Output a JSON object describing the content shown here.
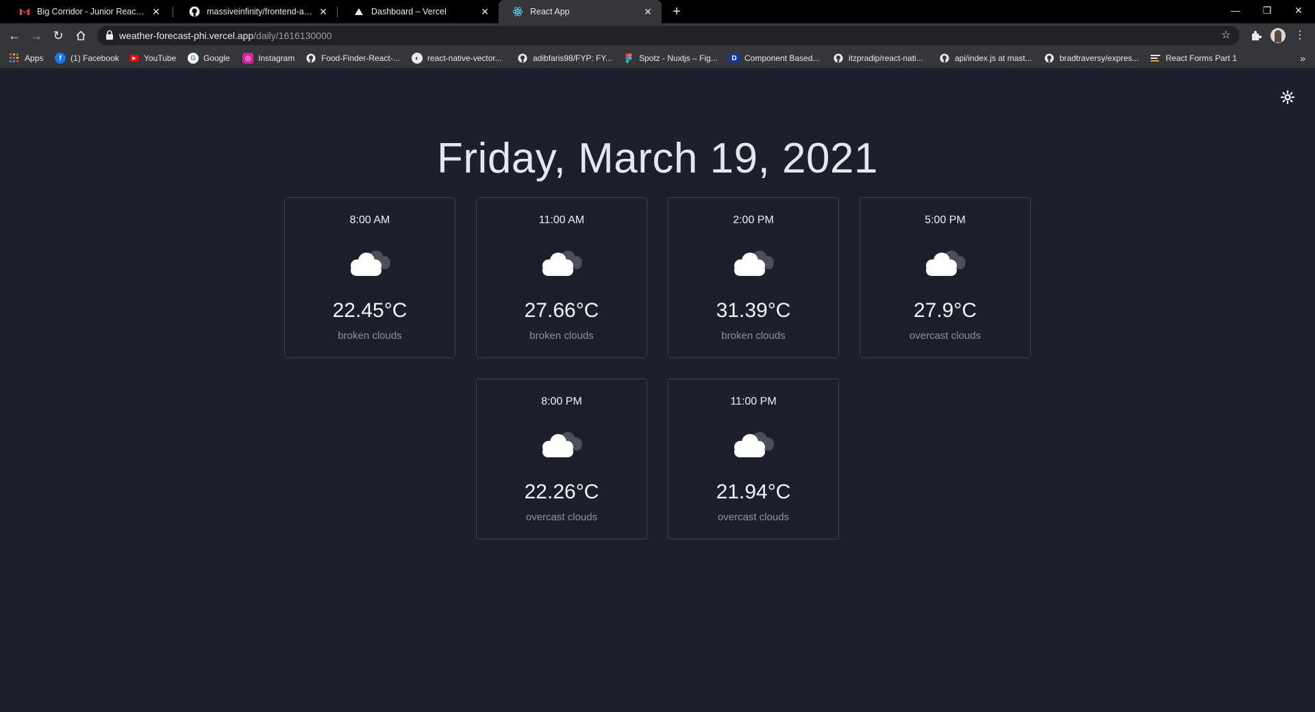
{
  "browser": {
    "tabs": [
      {
        "title": "Big Corridor - Junior ReactJS Dev",
        "icon": "gmail-icon"
      },
      {
        "title": "massiveinfinity/frontend-assessm",
        "icon": "github-icon"
      },
      {
        "title": "Dashboard – Vercel",
        "icon": "vercel-icon"
      },
      {
        "title": "React App",
        "icon": "react-icon"
      }
    ],
    "url_host": "weather-forecast-phi.vercel.app",
    "url_path": "/daily/1616130000",
    "bookmarks": [
      {
        "label": "Apps",
        "icon": "apps-grid-icon"
      },
      {
        "label": "(1) Facebook",
        "icon": "facebook-icon"
      },
      {
        "label": "YouTube",
        "icon": "youtube-icon"
      },
      {
        "label": "Google",
        "icon": "google-icon"
      },
      {
        "label": "Instagram",
        "icon": "instagram-icon"
      },
      {
        "label": "Food-Finder-React-...",
        "icon": "github-icon"
      },
      {
        "label": "react-native-vector...",
        "icon": "globe-icon"
      },
      {
        "label": "adibfaris98/FYP: FY...",
        "icon": "github-icon"
      },
      {
        "label": "Spotz - Nuxtjs – Fig...",
        "icon": "figma-icon"
      },
      {
        "label": "Component Based...",
        "icon": "d-icon"
      },
      {
        "label": "itzpradip/react-nati...",
        "icon": "github-icon"
      },
      {
        "label": "api/index.js at mast...",
        "icon": "github-icon"
      },
      {
        "label": "bradtraversy/expres...",
        "icon": "github-icon"
      },
      {
        "label": "React Forms Part 1",
        "icon": "form-icon"
      }
    ],
    "bookmarks_more": "»"
  },
  "page": {
    "date_title": "Friday, March 19, 2021",
    "theme_toggle_icon": "sun-icon",
    "forecasts": [
      {
        "time": "8:00 AM",
        "temp": "22.45°C",
        "description": "broken clouds",
        "icon": "broken-clouds-icon"
      },
      {
        "time": "11:00 AM",
        "temp": "27.66°C",
        "description": "broken clouds",
        "icon": "broken-clouds-icon"
      },
      {
        "time": "2:00 PM",
        "temp": "31.39°C",
        "description": "broken clouds",
        "icon": "broken-clouds-icon"
      },
      {
        "time": "5:00 PM",
        "temp": "27.9°C",
        "description": "overcast clouds",
        "icon": "overcast-clouds-icon"
      },
      {
        "time": "8:00 PM",
        "temp": "22.26°C",
        "description": "overcast clouds",
        "icon": "overcast-clouds-icon"
      },
      {
        "time": "11:00 PM",
        "temp": "21.94°C",
        "description": "overcast clouds",
        "icon": "overcast-clouds-icon"
      }
    ]
  },
  "colors": {
    "page_background": "#1b202c",
    "card_border": "#3a4150",
    "description_text": "#8b93a1"
  }
}
